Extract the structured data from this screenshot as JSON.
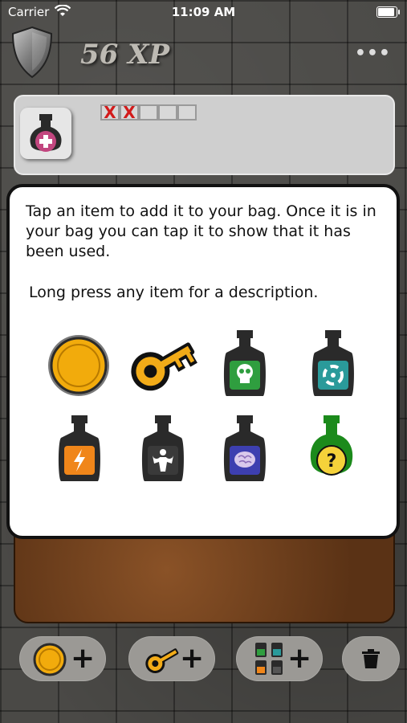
{
  "status_bar": {
    "carrier": "Carrier",
    "time": "11:09 AM"
  },
  "header": {
    "xp_text": "56 XP",
    "more_label": "•••"
  },
  "item_panel": {
    "selected_item_icon": "pink-health-potion-icon",
    "usage": [
      "X",
      "X",
      "",
      "",
      ""
    ]
  },
  "modal": {
    "instruction": "Tap an item to add it to your bag.  Once it is in your bag you can tap it to show that it has been used.",
    "hint": "Long press any item for a description.",
    "items": [
      {
        "name": "coin-item",
        "icon": "gold-coin-icon",
        "color": "#f0a800"
      },
      {
        "name": "key-item",
        "icon": "gold-key-icon",
        "color": "#f2ab18"
      },
      {
        "name": "poison-potion-item",
        "icon": "skull-potion-icon",
        "color": "#2f9e3f"
      },
      {
        "name": "vortex-potion-item",
        "icon": "vortex-potion-icon",
        "color": "#2a9a9a"
      },
      {
        "name": "energy-potion-item",
        "icon": "lightning-potion-icon",
        "color": "#f0861a"
      },
      {
        "name": "strength-potion-item",
        "icon": "strength-potion-icon",
        "color": "#3a3a3a"
      },
      {
        "name": "brain-potion-item",
        "icon": "brain-potion-icon",
        "color": "#3d3fb0"
      },
      {
        "name": "mystery-potion-item",
        "icon": "question-potion-icon",
        "color": "#1b8a1b"
      }
    ]
  },
  "toolbar": {
    "plus": "+",
    "add_coin_icon": "coin-plus-icon",
    "add_key_icon": "key-plus-icon",
    "add_potions_icon": "potions-plus-icon",
    "trash_icon": "trash-icon"
  }
}
